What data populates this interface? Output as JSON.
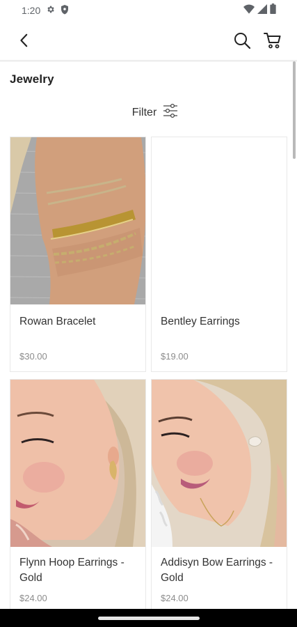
{
  "status_bar": {
    "time": "1:20",
    "left_icons": [
      "gear-icon",
      "shield-icon"
    ],
    "right_icons": [
      "wifi-icon",
      "signal-icon",
      "battery-icon"
    ]
  },
  "app_bar": {
    "back_icon": "chevron-left-icon",
    "search_icon": "search-icon",
    "cart_icon": "cart-icon"
  },
  "category": {
    "title": "Jewelry"
  },
  "filter": {
    "label": "Filter",
    "icon": "sliders-icon"
  },
  "products": [
    {
      "name": "Rowan Bracelet",
      "price": "$30.00",
      "image": "bracelet-photo"
    },
    {
      "name": "Bentley Earrings",
      "price": "$19.00",
      "image": "blank-image"
    },
    {
      "name": "Flynn Hoop Earrings - Gold",
      "price": "$24.00",
      "image": "earring-model-photo"
    },
    {
      "name": "Addisyn Bow Earrings - Gold",
      "price": "$24.00",
      "image": "earring-model-photo"
    }
  ],
  "colors": {
    "text": "#222222",
    "price": "#8c8c8c",
    "border": "#e8e8e8"
  }
}
